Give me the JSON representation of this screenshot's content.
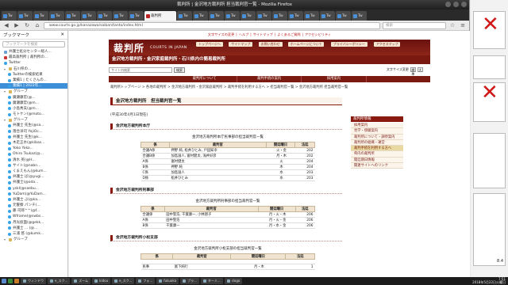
{
  "window": {
    "title": "裁判所 | 金沢地方裁判所 担当裁判官一覧 - Mozilla Firefox"
  },
  "tabs": [
    {
      "label": "Tw",
      "active": false
    },
    {
      "label": "Tw",
      "active": false
    },
    {
      "label": "Tw",
      "active": false
    },
    {
      "label": "Tw",
      "active": false
    },
    {
      "label": "Tw",
      "active": false
    },
    {
      "label": "Tw",
      "active": false
    },
    {
      "label": "Tw",
      "active": false
    },
    {
      "label": "Tw",
      "active": false
    },
    {
      "label": "Tw",
      "active": false
    },
    {
      "label": "裁判所",
      "active": true
    },
    {
      "label": "Tw",
      "active": false
    },
    {
      "label": "Tw",
      "active": false
    },
    {
      "label": "Tw",
      "active": false
    },
    {
      "label": "Tw",
      "active": false
    },
    {
      "label": "Tw",
      "active": false
    },
    {
      "label": "Tw",
      "active": false
    },
    {
      "label": "Tw",
      "active": false
    },
    {
      "label": "Tw",
      "active": false
    },
    {
      "label": "Tw",
      "active": false
    },
    {
      "label": "Tw",
      "active": false
    },
    {
      "label": "Tw",
      "active": false
    },
    {
      "label": "Tw",
      "active": false
    }
  ],
  "navbar": {
    "url": "www.courts.go.jp/kanazawa/saiban/tanto/index.html",
    "search_placeholder": "検索"
  },
  "sidebar": {
    "title": "ブックマーク",
    "search_placeholder": "ブックマークを検索",
    "items": [
      {
        "label": "弁護士処分センター総人...",
        "icon": "page",
        "indent": 1
      },
      {
        "label": "最高裁判所 | 裁判所の...",
        "icon": "red",
        "indent": 1
      },
      {
        "label": "Twitter",
        "icon": "tw",
        "indent": 1
      },
      {
        "label": "石川県の...",
        "icon": "folder",
        "indent": 1
      },
      {
        "label": "Twitterの検索結果",
        "icon": "tw",
        "indent": 2
      },
      {
        "label": "業績1 | たくさんの...",
        "icon": "tw",
        "indent": 2
      },
      {
        "label": "業績1 | 2022年...",
        "icon": "tw",
        "indent": 2,
        "selected": true
      },
      {
        "label": "グループ",
        "icon": "folder",
        "indent": 1
      },
      {
        "label": "廣瀬康宏(@...",
        "icon": "tw",
        "indent": 2
      },
      {
        "label": "廣瀬康宏(@m...",
        "icon": "tw",
        "indent": 2
      },
      {
        "label": "小島秀夫(@m...",
        "icon": "tw",
        "indent": 2
      },
      {
        "label": "モトケン(@moto...",
        "icon": "tw",
        "indent": 2
      },
      {
        "label": "グループ",
        "icon": "folder",
        "indent": 1
      },
      {
        "label": "弁護士 先生(@sa...",
        "icon": "tw",
        "indent": 2
      },
      {
        "label": "落合洋司 YojiOc...",
        "icon": "tw",
        "indent": 2
      },
      {
        "label": "弁護士 先生(@k...",
        "icon": "tw",
        "indent": 2
      },
      {
        "label": "木走正水(@kibas...",
        "icon": "tw",
        "indent": 2
      },
      {
        "label": "Yoko Yoko...",
        "icon": "tw",
        "indent": 2
      },
      {
        "label": "Ohiro Tsukaz(@...",
        "icon": "tw",
        "indent": 2
      },
      {
        "label": "清水 英(@H...",
        "icon": "tw",
        "indent": 2
      },
      {
        "label": "サイト(@nabn...",
        "icon": "tw",
        "indent": 2
      },
      {
        "label": "くまえもん(@kum...",
        "icon": "tw",
        "indent": 2
      },
      {
        "label": "弁護士 ば(@yugi...",
        "icon": "tw",
        "indent": 2
      },
      {
        "label": "弁護士(@oda...",
        "icon": "tw",
        "indent": 2
      },
      {
        "label": "yskl(@saebu...",
        "icon": "tw",
        "indent": 2
      },
      {
        "label": "YuDam(@YuDam...",
        "icon": "tw",
        "indent": 2
      },
      {
        "label": "弁護士 ぶ(@ka...",
        "icon": "tw",
        "indent": 2
      },
      {
        "label": "元警察 パンチ(...",
        "icon": "tw",
        "indent": 2
      },
      {
        "label": "藤 司郎^^(@f...",
        "icon": "tw",
        "indent": 2
      },
      {
        "label": "Wframe(@swbs...",
        "icon": "tw",
        "indent": 2
      },
      {
        "label": "月光仮面(@gekk...",
        "icon": "tw",
        "indent": 2
      },
      {
        "label": "弁護士 ... (@...",
        "icon": "tw",
        "indent": 2
      },
      {
        "label": "三浦 悠 (@kumk...",
        "icon": "tw",
        "indent": 2
      },
      {
        "label": "グループ",
        "icon": "folder",
        "indent": 1
      }
    ]
  },
  "site": {
    "top_notes": [
      "文字サイズの変更",
      "ヘルプ",
      "サイトマップ",
      "よくあるご質問",
      "アクセシビリティ"
    ],
    "logo": "裁判所",
    "logo_sub": "COURTS IN JAPAN",
    "header_pills": [
      "トップページへ",
      "サイトマップ",
      "お問い合わせ",
      "ホームページについて",
      "プライバシーポリシー",
      "アクセスマップ"
    ],
    "subtitle": "金沢地方裁判所・金沢家庭裁判所・石川県内の簡易裁判所",
    "search_placeholder": "サイト内検索",
    "search_button": "検索",
    "fontsize_label": "文字サイズ変更",
    "fontsize_options": [
      "標準",
      "大"
    ],
    "menu": [
      "",
      "裁判所について",
      "裁判手続の案内",
      "採用案内",
      ""
    ],
    "breadcrumbs": "裁判所トップページ > 各地の裁判所 > 金沢地方裁判所・金沢家庭裁判所 > 裁判手続を利用する方へ > 担当裁判官一覧 > 金沢地方裁判所 担当裁判官一覧",
    "page_title": "金沢地方裁判所　担当裁判官一覧",
    "date": "(平成30年4月1日現在)",
    "sections": [
      {
        "title": "金沢地方裁判所本庁",
        "caption": "金沢地方裁判所本庁民事部の担当裁判官一覧",
        "headers": [
          "係",
          "裁判官",
          "開廷曜日",
          "法廷"
        ],
        "rows": [
          [
            "合議A係",
            "押野 純, 松井ひとみ, 戸田知幸",
            "火・金",
            "202"
          ],
          [
            "合議B係",
            "加島滋人, 富村健太, 浅井好彦",
            "月・木",
            "202"
          ],
          [
            "A係",
            "富村健太",
            "火",
            "204"
          ],
          [
            "B係",
            "押野 純",
            "木",
            "204"
          ],
          [
            "C係",
            "加島滋人",
            "水",
            "203"
          ],
          [
            "D係",
            "松井ひとみ",
            "水",
            "203"
          ]
        ]
      },
      {
        "title": "金沢地方裁判所刑事部",
        "caption": "金沢地方裁判所刑事部の担当裁判官一覧",
        "headers": [
          "係",
          "裁判官",
          "開廷曜日",
          "法廷"
        ],
        "rows": [
          [
            "合議係",
            "田中聖浩, 千葉康一, 小林朋子",
            "月・火・木",
            "206"
          ],
          [
            "A係",
            "田中聖浩",
            "月・火・金",
            "206"
          ],
          [
            "B係",
            "千葉康一",
            "月・水・金",
            "206"
          ]
        ]
      },
      {
        "title": "金沢地方裁判所小松支部",
        "caption": "金沢地方裁判所小松支部の担当裁判官一覧",
        "headers": [
          "係",
          "裁判官",
          "開廷曜日",
          "法廷"
        ],
        "rows": [
          [
            "",
            "",
            "",
            ""
          ],
          [
            "民事",
            "富下純行",
            "月・木",
            "1"
          ]
        ]
      }
    ],
    "right_nav_title": "裁判所情報",
    "right_nav": [
      {
        "label": "採用案内"
      },
      {
        "label": "見学・傍聴案内"
      },
      {
        "label": "裁判所について・調停案内"
      },
      {
        "label": "裁判所の組織・運営"
      },
      {
        "label": "裁判手続を利用する方へ",
        "hi": true
      },
      {
        "label": "県内の裁判所"
      },
      {
        "label": "開廷期日情報"
      },
      {
        "label": "関連サイトへのリンク"
      }
    ]
  },
  "desktop": {
    "badge": "8.4"
  },
  "taskbar": {
    "tasks": [
      "ウィンドウ",
      "e_スク...",
      "ズーム",
      "kidou",
      "e_スク...",
      "フォ...",
      "fukuoka",
      "ブラ...",
      "ターミ...",
      "slogo"
    ],
    "time": "7:51",
    "date": "2018年5月22日火曜日"
  }
}
